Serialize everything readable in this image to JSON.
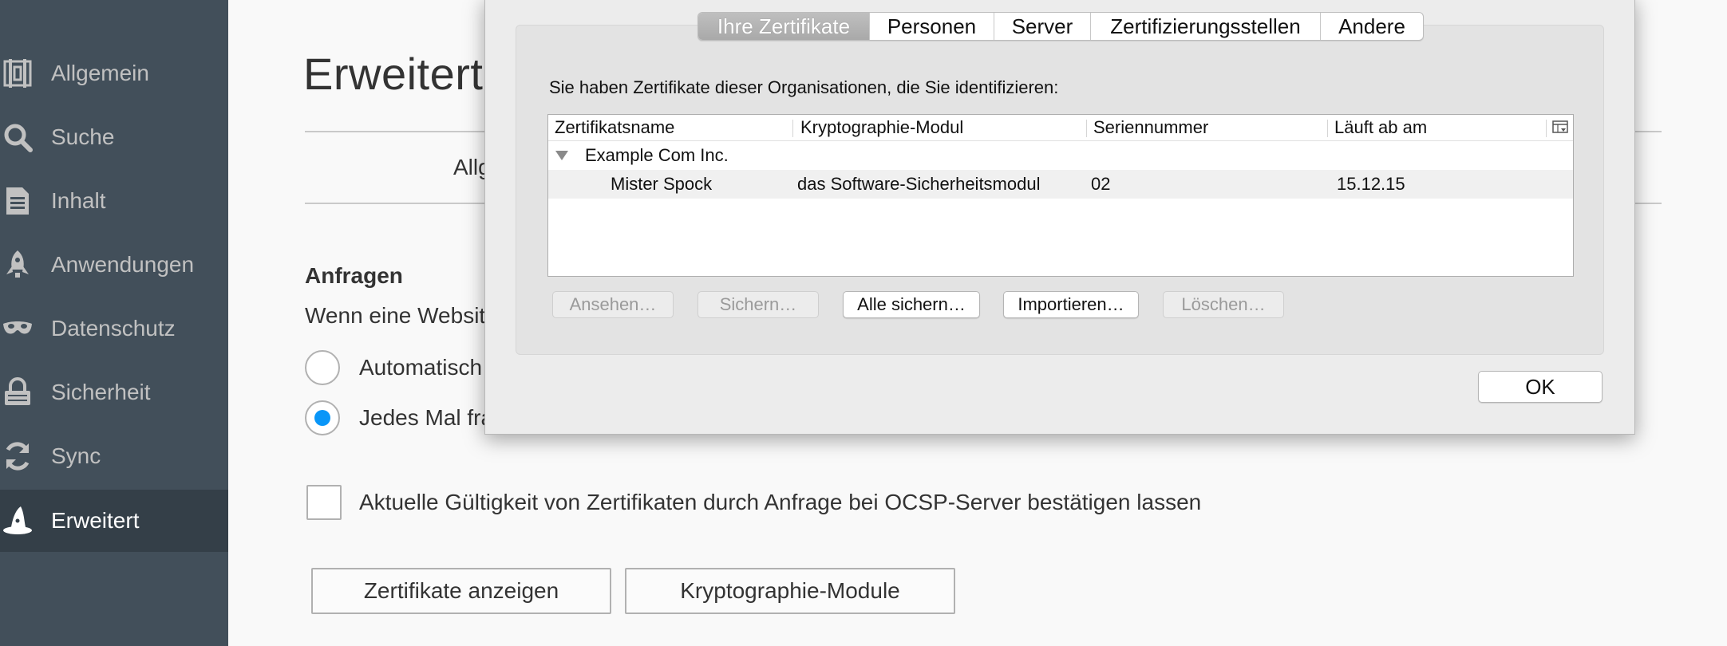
{
  "sidebar": {
    "items": [
      {
        "label": "Allgemein",
        "icon": "general-icon"
      },
      {
        "label": "Suche",
        "icon": "search-icon"
      },
      {
        "label": "Inhalt",
        "icon": "content-icon"
      },
      {
        "label": "Anwendungen",
        "icon": "applications-icon"
      },
      {
        "label": "Datenschutz",
        "icon": "privacy-mask-icon"
      },
      {
        "label": "Sicherheit",
        "icon": "lock-icon"
      },
      {
        "label": "Sync",
        "icon": "sync-icon"
      },
      {
        "label": "Erweitert",
        "icon": "wizard-hat-icon"
      }
    ],
    "active_index": 7,
    "background": "#424f5a",
    "active_background": "#343f48"
  },
  "main": {
    "title": "Erweitert",
    "tab_partial": "Allg",
    "section_heading": "Anfragen",
    "section_text": "Wenn eine Website",
    "radio_options": [
      {
        "label": "Automatisch",
        "checked": false
      },
      {
        "label": "Jedes Mal fra",
        "checked": true
      }
    ],
    "ocsp_checkbox": {
      "label": "Aktuelle Gültigkeit von Zertifikaten durch Anfrage bei OCSP-Server bestätigen lassen",
      "checked": false
    },
    "buttons": {
      "view_certificates": "Zertifikate anzeigen",
      "crypto_modules": "Kryptographie-Module"
    },
    "accent_color": "#0996f8"
  },
  "dialog": {
    "tabs": [
      "Ihre Zertifikate",
      "Personen",
      "Server",
      "Zertifizierungsstellen",
      "Andere"
    ],
    "selected_tab": 0,
    "description": "Sie haben Zertifikate dieser Organisationen, die Sie identifizieren:",
    "table": {
      "columns": [
        "Zertifikatsname",
        "Kryptographie-Modul",
        "Seriennummer",
        "Läuft ab am"
      ],
      "column_picker_icon": "column-picker-icon",
      "group": "Example Com Inc.",
      "rows": [
        {
          "name": "Mister Spock",
          "module": "das Software-Sicherheitsmodul",
          "serial": "02",
          "expires": "15.12.15"
        }
      ]
    },
    "buttons": {
      "view": "Ansehen…",
      "backup": "Sichern…",
      "backup_all": "Alle sichern…",
      "import": "Importieren…",
      "delete": "Löschen…"
    },
    "ok": "OK"
  }
}
